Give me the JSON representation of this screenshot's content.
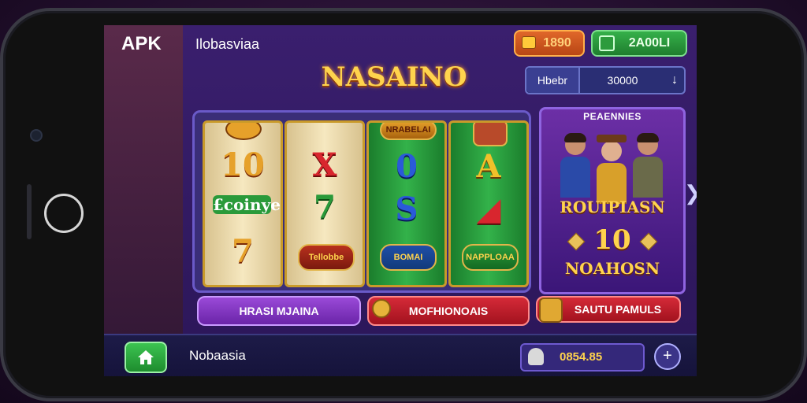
{
  "header": {
    "apk_label": "APK",
    "app_name": "Ilobasviaa",
    "coins_value": "1890",
    "gems_value": "2A00LI",
    "bet_label": "Hbebr",
    "bet_value": "30000",
    "bet_arrow": "↓"
  },
  "logo": {
    "text": "NASAINO"
  },
  "reels": [
    {
      "symbols": [
        "10",
        "£coinye",
        "7"
      ]
    },
    {
      "symbols": [
        "X",
        "7",
        "Tellobbe"
      ]
    },
    {
      "symbols": [
        "0",
        "S",
        "BOMAI"
      ]
    },
    {
      "symbols": [
        "A",
        "◢",
        "NAPPLOAA"
      ]
    }
  ],
  "reel_badges": {
    "reel3_top": "NRABELAI",
    "reel4_badge": "NAPPLOAA"
  },
  "promo": {
    "title": "PEAENNIES",
    "line1": "ROUIPIASN",
    "line2": "10",
    "line3": "NOAHOSN"
  },
  "actions": {
    "btn1": "HRASI MJAINA",
    "btn2": "MOFHIONOAIS",
    "btn3": "SAUTU PAMULS"
  },
  "bottom": {
    "label": "Nobaasia",
    "balance": "0854.85",
    "plus": "+"
  },
  "colors": {
    "accent_gold": "#ffd34d",
    "screen_bg": "#3a1f6e",
    "btn_purple": "#9a4ad8",
    "btn_red": "#d52a38",
    "btn_green": "#35b04a"
  }
}
